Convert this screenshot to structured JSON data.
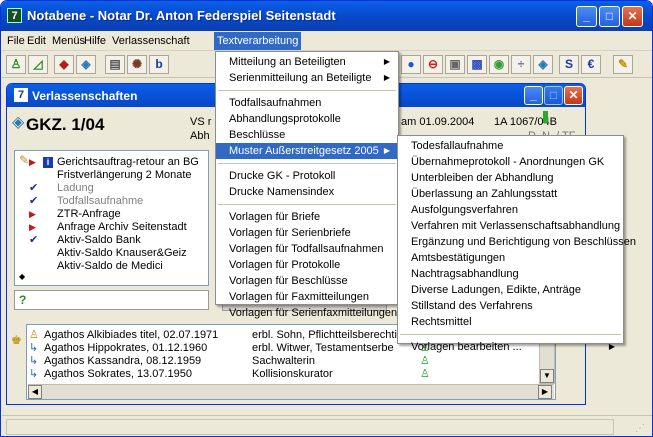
{
  "window": {
    "title": "Notabene - Notar Dr. Anton Federspiel Seitenstadt",
    "minimize": "_",
    "maximize": "□",
    "close": "✕"
  },
  "menubar": [
    "File",
    "Edit",
    "Menüs",
    "Hilfe",
    "Verlassenschaft",
    "Textverarbeitung"
  ],
  "mdi": {
    "title": "Verlassenschaften",
    "case_id": "GKZ. 1/04",
    "vs_label": "VS r",
    "abh_label": "Abh",
    "date_label": "am 01.09.2004",
    "ref": "1A 1067/04B",
    "ref2": "D. N. / TF"
  },
  "tree": [
    {
      "text": "Gerichtsauftrag-retour an BG",
      "mark": "arrow-info",
      "grey": false
    },
    {
      "text": "Fristverlängerung 2 Monate",
      "mark": "",
      "grey": false
    },
    {
      "text": "Ladung",
      "mark": "check",
      "grey": true
    },
    {
      "text": "Todfallsaufnahme",
      "mark": "check",
      "grey": true
    },
    {
      "text": "ZTR-Anfrage",
      "mark": "arrow",
      "grey": false
    },
    {
      "text": "Anfrage Archiv Seitenstadt",
      "mark": "arrow",
      "grey": false
    },
    {
      "text": "Aktiv-Saldo Bank",
      "mark": "check",
      "grey": false
    },
    {
      "text": "Aktiv-Saldo Knauser&Geiz",
      "mark": "",
      "grey": false
    },
    {
      "text": "Aktiv-Saldo de Medici",
      "mark": "",
      "grey": false
    }
  ],
  "parties": [
    {
      "name": "Agathos Alkibiades titel, 02.07.1971",
      "role": "erbl. Sohn, Pflichtteilsberechtigter"
    },
    {
      "name": "Agathos Hippokrates, 01.12.1960",
      "role": "erbl. Witwer, Testamentserbe"
    },
    {
      "name": "Agathos Kassandra, 08.12.1959",
      "role": "Sachwalterin"
    },
    {
      "name": "Agathos Sokrates, 13.07.1950",
      "role": "Kollisionskurator"
    }
  ],
  "menu1": [
    {
      "label": "Mitteilung an Beteiligten",
      "sub": true
    },
    {
      "label": "Serienmitteilung an Beteiligte",
      "sub": true
    },
    {
      "sep": true
    },
    {
      "label": "Todfallsaufnahmen"
    },
    {
      "label": "Abhandlungsprotokolle"
    },
    {
      "label": "Beschlüsse"
    },
    {
      "label": "Muster Außerstreitgesetz 2005",
      "sub": true,
      "hl": true
    },
    {
      "sep": true
    },
    {
      "label": "Drucke GK - Protokoll"
    },
    {
      "label": "Drucke Namensindex"
    },
    {
      "sep": true
    },
    {
      "label": "Vorlagen für Briefe"
    },
    {
      "label": "Vorlagen für Serienbriefe"
    },
    {
      "label": "Vorlagen für Todfallsaufnahmen"
    },
    {
      "label": "Vorlagen für Protokolle"
    },
    {
      "label": "Vorlagen für Beschlüsse"
    },
    {
      "label": "Vorlagen für Faxmitteilungen"
    },
    {
      "label": "Vorlagen für Serienfaxmitteilungen"
    }
  ],
  "menu2": [
    {
      "label": "Todesfallaufnahme"
    },
    {
      "label": "Übernahmeprotokoll - Anordnungen GK"
    },
    {
      "label": "Unterbleiben der Abhandlung"
    },
    {
      "label": "Überlassung an Zahlungsstatt"
    },
    {
      "label": "Ausfolgungsverfahren"
    },
    {
      "label": "Verfahren mit Verlassenschaftsabhandlung"
    },
    {
      "label": "Ergänzung und Berichtigung von Beschlüssen"
    },
    {
      "label": "Amtsbestätigungen"
    },
    {
      "label": "Nachtragsabhandlung"
    },
    {
      "label": "Diverse Ladungen, Edikte, Anträge"
    },
    {
      "label": "Stillstand des Verfahrens"
    },
    {
      "label": "Rechtsmittel"
    },
    {
      "sep": true
    },
    {
      "label": "Vorlagen bearbeiten ...",
      "sub": true
    }
  ],
  "colors": {
    "titlebar": "#0748c8",
    "highlight": "#316ac5",
    "face": "#ece9d8"
  }
}
